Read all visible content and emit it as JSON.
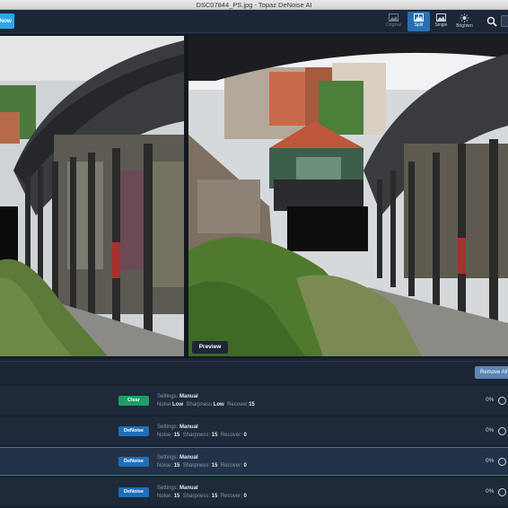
{
  "window": {
    "title": "DSC07844_PS.jpg - Topaz DeNoise AI"
  },
  "toolbar": {
    "open_label": "Now",
    "views": [
      {
        "label": "Original",
        "icon": "image-icon",
        "state": "dim"
      },
      {
        "label": "Split",
        "icon": "split-view-icon",
        "state": "active"
      },
      {
        "label": "Single",
        "icon": "single-view-icon",
        "state": "normal"
      },
      {
        "label": "Brighten",
        "icon": "brighten-icon",
        "state": "normal"
      }
    ]
  },
  "viewer": {
    "preview_label": "Preview"
  },
  "queue": {
    "remove_all_label": "Remove All",
    "settings_label": "Settings:",
    "noise_label": "Noise:",
    "sharpness_label": "Sharpness:",
    "recover_label": "Recover:",
    "rows": [
      {
        "model": "Clear",
        "model_color": "#1d9e67",
        "mode": "Manual",
        "noise": "Low",
        "sharpness": "Low",
        "recover": "15",
        "progress": "0%",
        "selected": false
      },
      {
        "model": "DeNoise",
        "model_color": "#1e6fb9",
        "mode": "Manual",
        "noise": "15",
        "sharpness": "15",
        "recover": "0",
        "progress": "0%",
        "selected": false
      },
      {
        "model": "DeNoise",
        "model_color": "#1e6fb9",
        "mode": "Manual",
        "noise": "15",
        "sharpness": "15",
        "recover": "0",
        "progress": "0%",
        "selected": true
      },
      {
        "model": "DeNoise",
        "model_color": "#1e6fb9",
        "mode": "Manual",
        "noise": "15",
        "sharpness": "15",
        "recover": "0",
        "progress": "0%",
        "selected": false
      }
    ]
  },
  "colors": {
    "accent": "#2aa8e6",
    "active_view": "#2a6fb0",
    "clear_green": "#1d9e67",
    "denoise_blue": "#1e6fb9"
  }
}
